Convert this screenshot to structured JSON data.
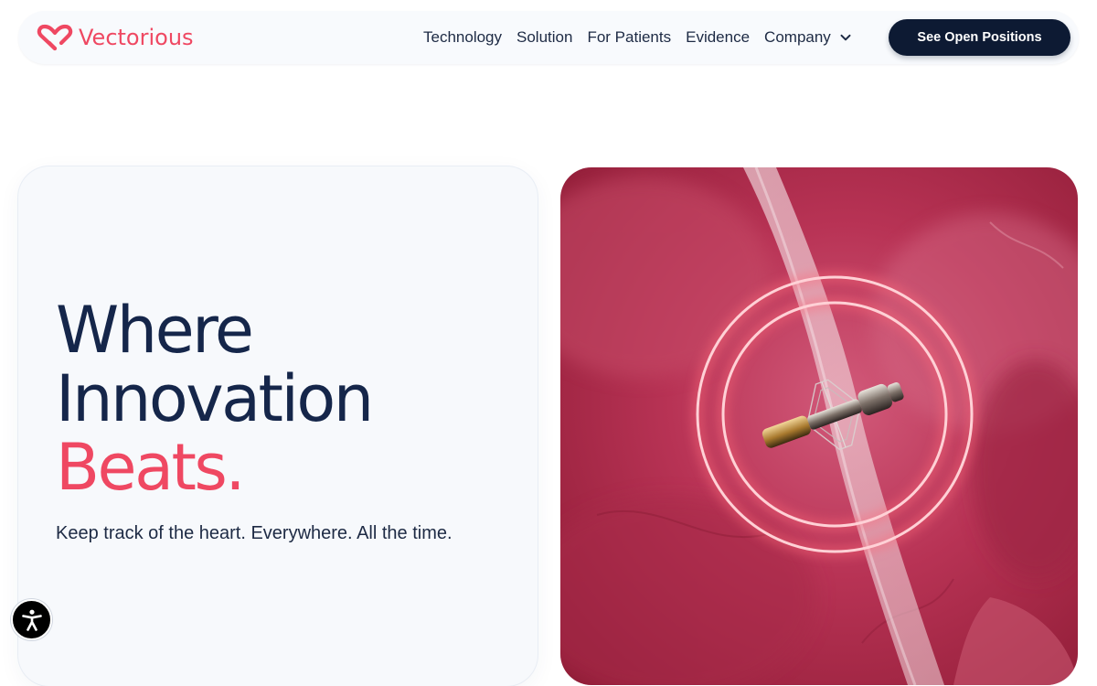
{
  "header": {
    "brand_name": "Vectorious",
    "nav": [
      {
        "label": "Technology"
      },
      {
        "label": "Solution"
      },
      {
        "label": "For Patients"
      },
      {
        "label": "Evidence"
      },
      {
        "label": "Company",
        "dropdown": true
      }
    ],
    "cta_label": "See Open Positions"
  },
  "hero": {
    "headline_line1": "Where",
    "headline_line2": "Innovation",
    "headline_accent": "Beats.",
    "subheadline": "Keep track of the heart. Everywhere. All the time."
  },
  "icons": {
    "logo": "heart-logo-icon",
    "nav_dropdown": "chevron-down-icon",
    "accessibility": "accessibility-person-icon"
  },
  "colors": {
    "brand_accent": "#ef4862",
    "navy": "#15264a",
    "cta_background": "#0d1a33",
    "card_background": "#f7f9fc"
  }
}
